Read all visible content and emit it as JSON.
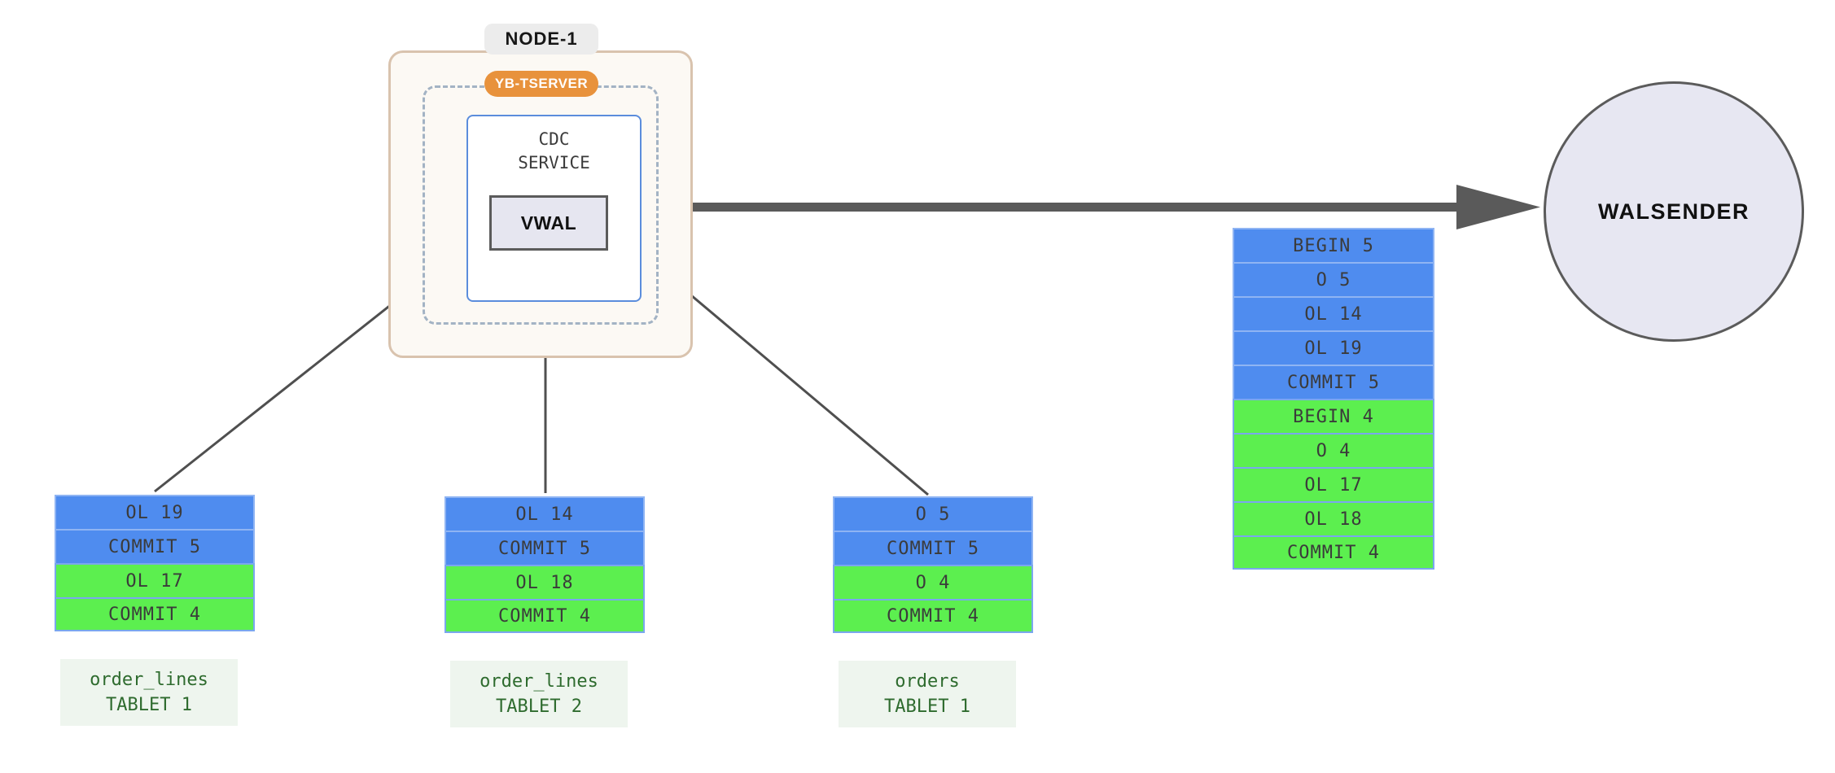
{
  "node": {
    "label": "NODE-1",
    "tserver_label": "YB-TSERVER",
    "cdc_label": "CDC\nSERVICE",
    "vwal_label": "VWAL"
  },
  "walsender": {
    "label": "WALSENDER"
  },
  "colors": {
    "txn5_blue": "#4f8cef",
    "txn4_green": "#5cef4f",
    "row_border": "#7aa7ee",
    "node_border": "#d9c3ae",
    "node_fill": "#fcf9f4",
    "tserver_orange": "#e8923c",
    "tserver_dash": "#a3b3c4",
    "cdc_border": "#5b8ddc",
    "vwal_fill": "#e6e6f0",
    "vwal_border": "#5b5b5b",
    "walsender_fill": "#e7e7f2",
    "arrow_gray": "#4f4f4f",
    "tablet_cap_fill": "#eef5ee",
    "tablet_cap_text": "#2e6b2e"
  },
  "tablets": [
    {
      "name": "tablet-order-lines-1",
      "caption": "order_lines\nTABLET 1",
      "rows": [
        {
          "label": "OL 19",
          "txn": "blue"
        },
        {
          "label": "COMMIT 5",
          "txn": "blue"
        },
        {
          "label": "OL 17",
          "txn": "green"
        },
        {
          "label": "COMMIT 4",
          "txn": "green"
        }
      ]
    },
    {
      "name": "tablet-order-lines-2",
      "caption": "order_lines\nTABLET 2",
      "rows": [
        {
          "label": "OL 14",
          "txn": "blue"
        },
        {
          "label": "COMMIT 5",
          "txn": "blue"
        },
        {
          "label": "OL 18",
          "txn": "green"
        },
        {
          "label": "COMMIT 4",
          "txn": "green"
        }
      ]
    },
    {
      "name": "tablet-orders-1",
      "caption": "orders\nTABLET 1",
      "rows": [
        {
          "label": "O 5",
          "txn": "blue"
        },
        {
          "label": "COMMIT 5",
          "txn": "blue"
        },
        {
          "label": "O 4",
          "txn": "green"
        },
        {
          "label": "COMMIT 4",
          "txn": "green"
        }
      ]
    }
  ],
  "output_stream": {
    "name": "vwal-ordered-stream",
    "rows": [
      {
        "label": "BEGIN 5",
        "txn": "blue"
      },
      {
        "label": "O 5",
        "txn": "blue"
      },
      {
        "label": "OL 14",
        "txn": "blue"
      },
      {
        "label": "OL 19",
        "txn": "blue"
      },
      {
        "label": "COMMIT 5",
        "txn": "blue"
      },
      {
        "label": "BEGIN 4",
        "txn": "green"
      },
      {
        "label": "O 4",
        "txn": "green"
      },
      {
        "label": "OL 17",
        "txn": "green"
      },
      {
        "label": "OL 18",
        "txn": "green"
      },
      {
        "label": "COMMIT 4",
        "txn": "green"
      }
    ]
  }
}
